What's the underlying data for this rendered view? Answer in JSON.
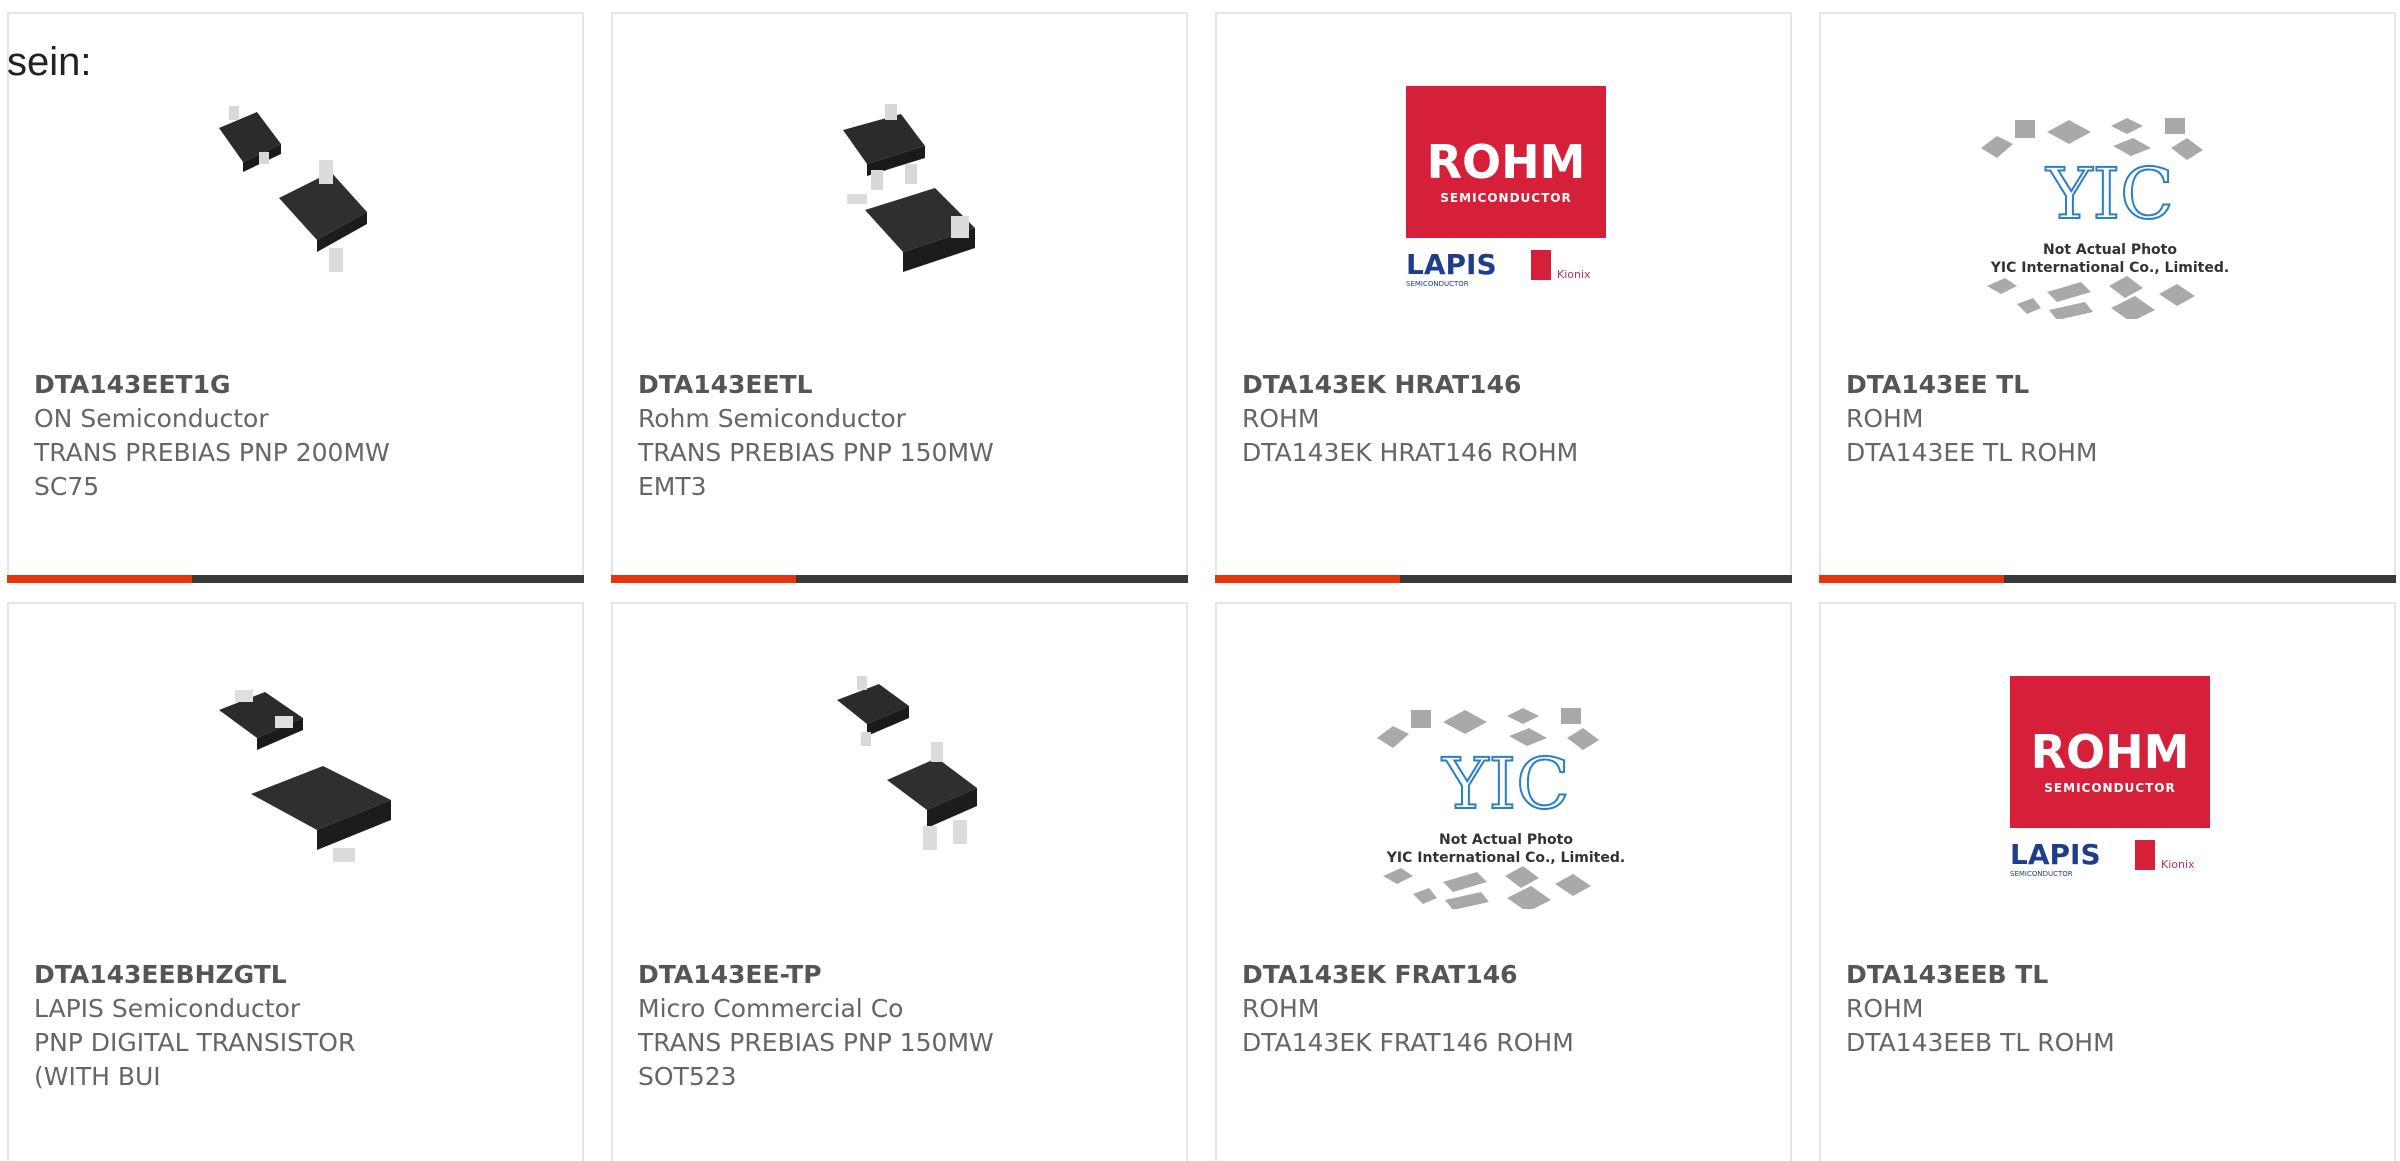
{
  "intro_text": "sein:",
  "colors": {
    "accent": "#e8340b",
    "bar": "#3a3a3a"
  },
  "products": [
    {
      "part": "DTA143EET1G",
      "maker": "ON Semiconductor",
      "desc1": "TRANS PREBIAS PNP 200MW",
      "desc2": "SC75",
      "image": "sot-package-photo"
    },
    {
      "part": "DTA143EETL",
      "maker": "Rohm Semiconductor",
      "desc1": "TRANS PREBIAS PNP 150MW",
      "desc2": "EMT3",
      "image": "sot-package-photo"
    },
    {
      "part": "DTA143EK HRAT146",
      "maker": "ROHM",
      "desc1": "DTA143EK HRAT146 ROHM",
      "desc2": "",
      "image": "rohm-logo",
      "logo": {
        "brand": "ROHM",
        "sub": "SEMICONDUCTOR",
        "lapis": "LAPIS",
        "lapis_sub": "SEMICONDUCTOR",
        "kionix": "Kionix"
      }
    },
    {
      "part": "DTA143EE TL",
      "maker": "ROHM",
      "desc1": "DTA143EE TL ROHM",
      "desc2": "",
      "image": "yic-placeholder",
      "placeholder": {
        "logo": "YIC",
        "line1": "Not Actual Photo",
        "line2": "YIC International Co., Limited."
      }
    },
    {
      "part": "DTA143EEBHZGTL",
      "maker": "LAPIS Semiconductor",
      "desc1": "PNP DIGITAL TRANSISTOR",
      "desc2": "(WITH BUI",
      "image": "sot-package-photo"
    },
    {
      "part": "DTA143EE-TP",
      "maker": "Micro Commercial Co",
      "desc1": "TRANS PREBIAS PNP 150MW",
      "desc2": "SOT523",
      "image": "sot-package-photo"
    },
    {
      "part": "DTA143EK FRAT146",
      "maker": "ROHM",
      "desc1": "DTA143EK FRAT146 ROHM",
      "desc2": "",
      "image": "yic-placeholder",
      "placeholder": {
        "logo": "YIC",
        "line1": "Not Actual Photo",
        "line2": "YIC International Co., Limited."
      }
    },
    {
      "part": "DTA143EEB TL",
      "maker": "ROHM",
      "desc1": "DTA143EEB TL ROHM",
      "desc2": "",
      "image": "rohm-logo",
      "logo": {
        "brand": "ROHM",
        "sub": "SEMICONDUCTOR",
        "lapis": "LAPIS",
        "lapis_sub": "SEMICONDUCTOR",
        "kionix": "Kionix"
      }
    }
  ]
}
